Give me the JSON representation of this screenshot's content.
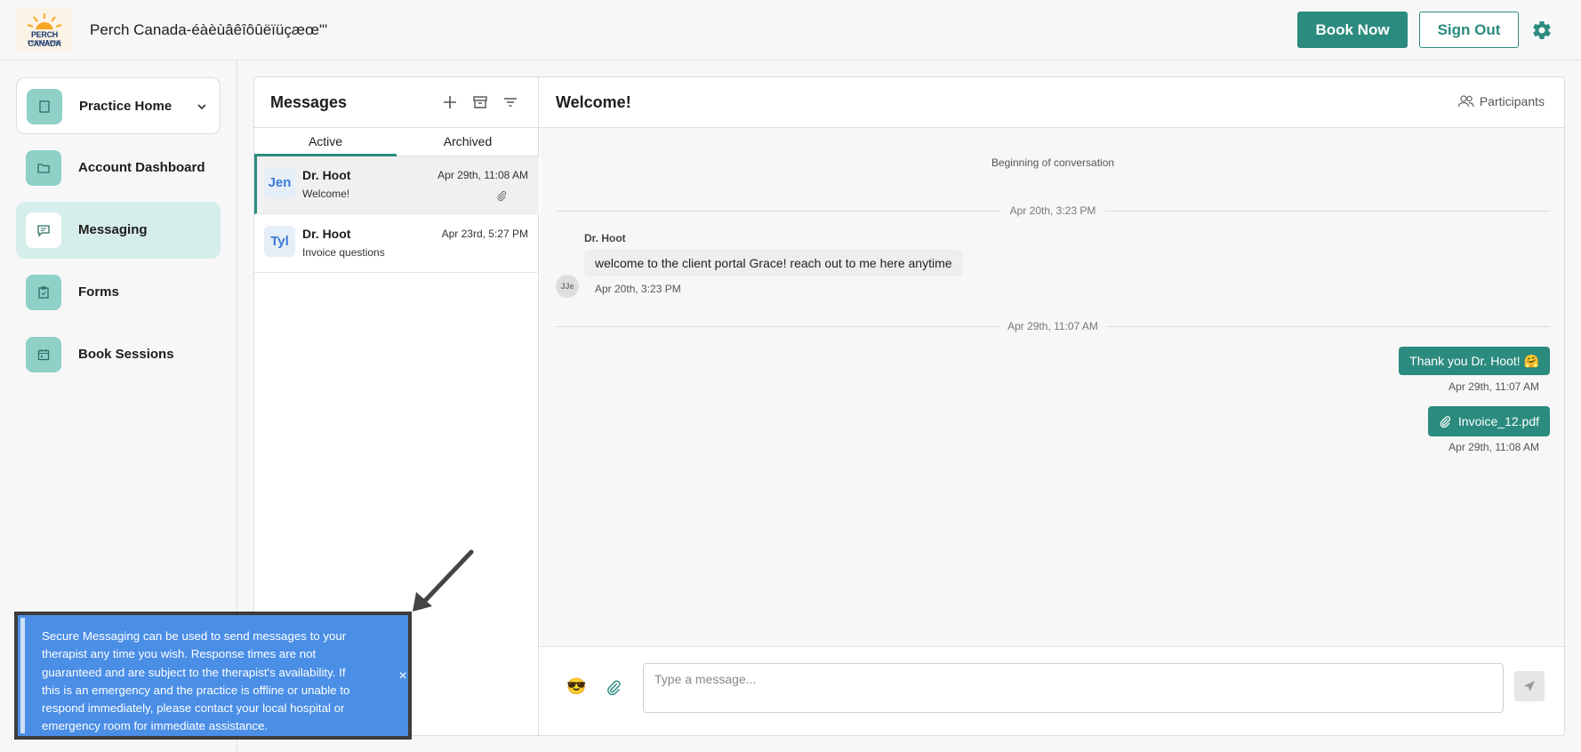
{
  "header": {
    "logo_line1": "PERCH CANADA",
    "logo_line2": "COUNSELING",
    "app_title": "Perch Canada-éàèùâêîôûëïüçæœ\"'",
    "book_now_label": "Book Now",
    "sign_out_label": "Sign Out",
    "accent_color": "#2b8b7e"
  },
  "sidebar": {
    "items": [
      {
        "label": "Practice Home",
        "icon": "building-icon"
      },
      {
        "label": "Account Dashboard",
        "icon": "folder-icon"
      },
      {
        "label": "Messaging",
        "icon": "message-icon",
        "active": true
      },
      {
        "label": "Forms",
        "icon": "clipboard-icon"
      },
      {
        "label": "Book Sessions",
        "icon": "calendar-icon"
      }
    ]
  },
  "messages": {
    "title": "Messages",
    "tabs": [
      "Active",
      "Archived"
    ],
    "conversations": [
      {
        "initials": "Jen",
        "name": "Dr. Hoot",
        "subject": "Welcome!",
        "time": "Apr 29th, 11:08 AM",
        "has_attachment": true,
        "selected": true
      },
      {
        "initials": "Tyl",
        "name": "Dr. Hoot",
        "subject": "Invoice questions",
        "time": "Apr 23rd, 5:27 PM",
        "has_attachment": false,
        "selected": false
      }
    ]
  },
  "chat": {
    "title": "Welcome!",
    "participants_label": "Participants",
    "beginning_label": "Beginning of conversation",
    "divider1": "Apr 20th, 3:23 PM",
    "incoming": {
      "sender": "Dr. Hoot",
      "text": "welcome to the client portal Grace! reach out to me here anytime",
      "time": "Apr 20th, 3:23 PM",
      "avatar_initials": "JJe"
    },
    "divider2": "Apr 29th, 11:07 AM",
    "outgoing": [
      {
        "text": "Thank you Dr. Hoot! 🤗",
        "time": "Apr 29th, 11:07 AM"
      },
      {
        "text": "Invoice_12.pdf",
        "time": "Apr 29th, 11:08 AM",
        "is_file": true
      }
    ],
    "composer": {
      "emoji": "😎",
      "placeholder": "Type a message..."
    }
  },
  "tooltip": {
    "text": "Secure Messaging can be used to send messages to your therapist any time you wish. Response times are not guaranteed and are subject to the therapist's availability. If this is an emergency and the practice is offline or unable to respond immediately, please contact your local hospital or emergency room for immediate assistance.",
    "close_symbol": "×",
    "background_color": "#4a8ee6"
  }
}
